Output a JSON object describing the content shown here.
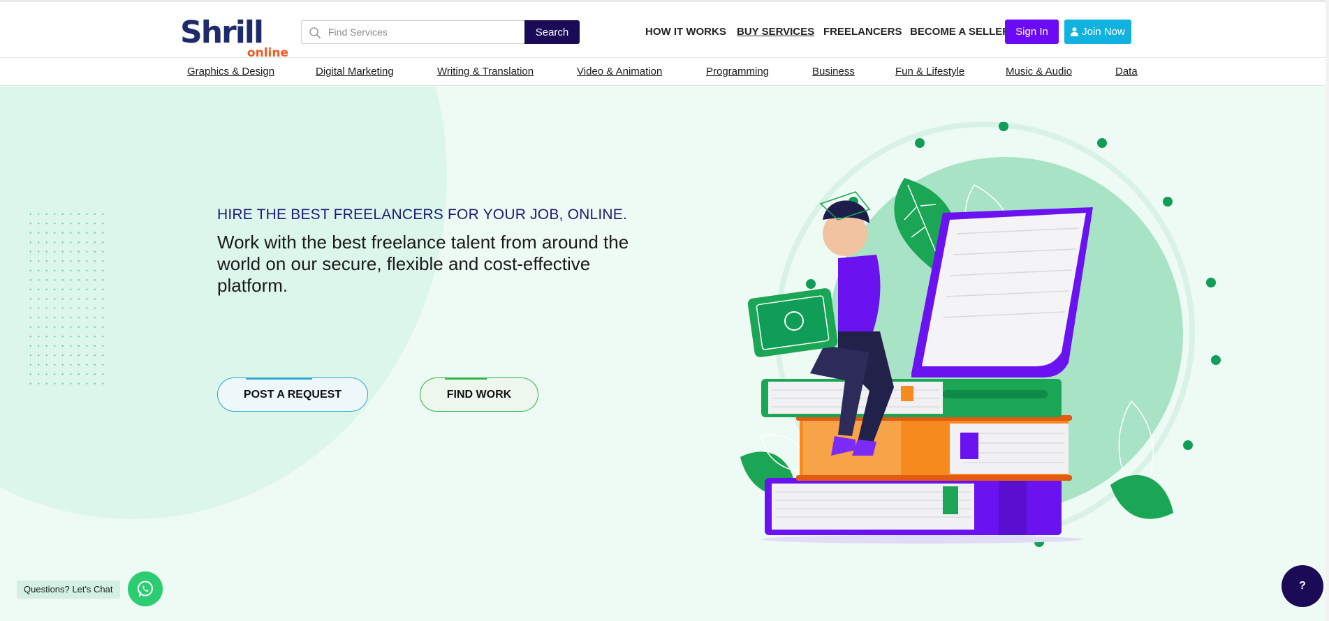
{
  "brand": {
    "name": "Shrill",
    "suffix": "online"
  },
  "search": {
    "placeholder": "Find Services",
    "value": "",
    "button": "Search"
  },
  "nav": {
    "items": [
      "HOW IT WORKS",
      "BUY SERVICES",
      "FREELANCERS",
      "BECOME A SELLER"
    ],
    "sign_in": "Sign In",
    "join_now": "Join Now"
  },
  "categories": [
    "Graphics & Design",
    "Digital Marketing",
    "Writing & Translation",
    "Video & Animation",
    "Programming",
    "Business",
    "Fun & Lifestyle",
    "Music & Audio",
    "Data"
  ],
  "hero": {
    "kicker": "HIRE THE BEST FREELANCERS FOR YOUR JOB, ONLINE.",
    "headline": "Work with the best freelance talent from around the world on our secure, flexible and cost-effective platform.",
    "post_request": "POST A REQUEST",
    "find_work": "FIND WORK"
  },
  "chat": {
    "label": "Questions? Let's Chat"
  },
  "help": {
    "label": "?"
  },
  "colors": {
    "brand_navy": "#1d2b6b",
    "brand_orange": "#f05a23",
    "search_button": "#1b0a55",
    "sign_in": "#6b0bf5",
    "join_now": "#12b2e0",
    "hero_bg": "#eefaf4",
    "kicker": "#1d1a74",
    "whatsapp": "#2ccc72"
  },
  "icons": [
    "search-icon",
    "user-icon",
    "whatsapp-icon",
    "question-icon"
  ]
}
